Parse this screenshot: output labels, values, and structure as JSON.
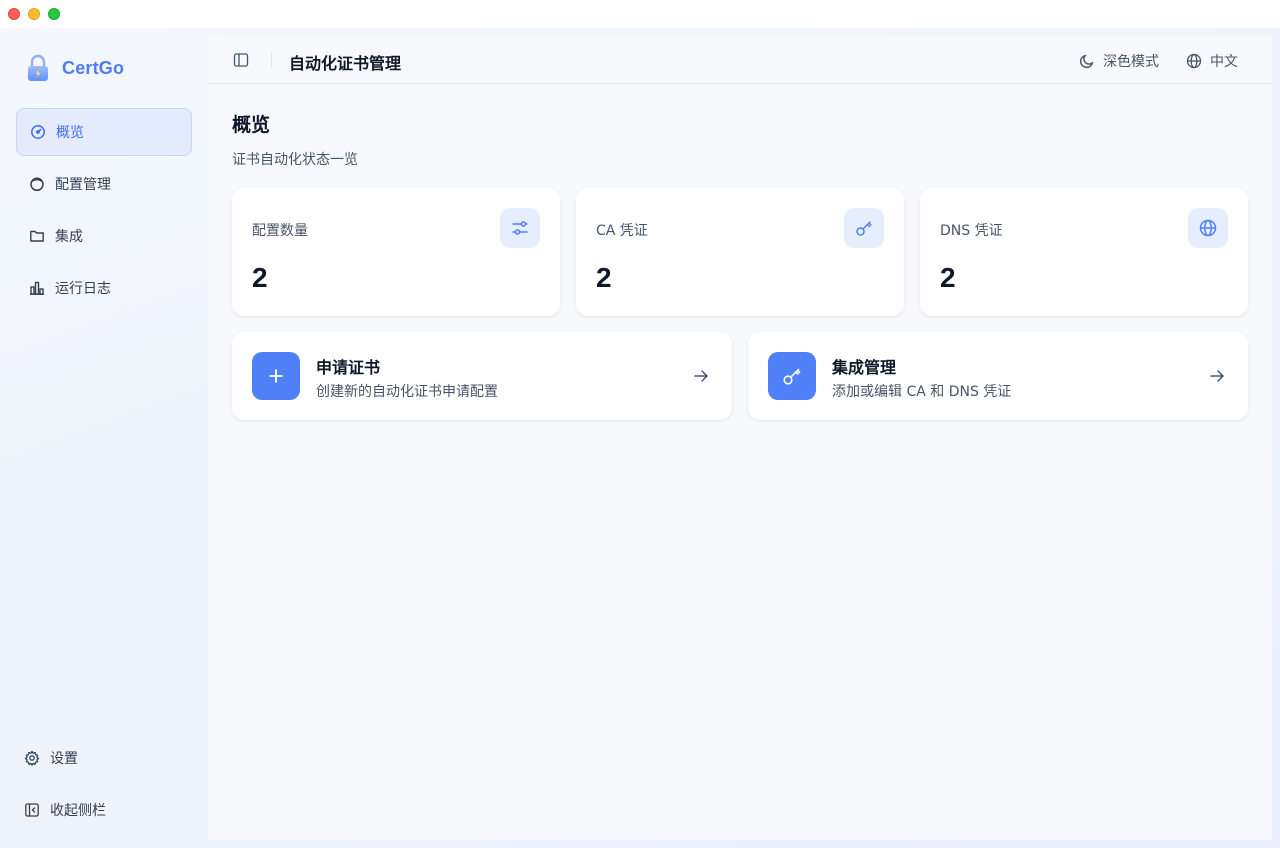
{
  "window": {
    "controls": [
      "close",
      "minimize",
      "maximize"
    ]
  },
  "sidebar": {
    "brand": {
      "name": "CertGo",
      "icon": "lock-icon",
      "color": "#4d7cf5"
    },
    "items": [
      {
        "label": "概览",
        "icon": "dashboard-icon",
        "active": true
      },
      {
        "label": "配置管理",
        "icon": "circle-icon",
        "active": false
      },
      {
        "label": "集成",
        "icon": "folder-icon",
        "active": false
      },
      {
        "label": "运行日志",
        "icon": "bar-chart-icon",
        "active": false
      }
    ],
    "settings_label": "设置",
    "collapse_label": "收起侧栏"
  },
  "header": {
    "title": "自动化证书管理",
    "theme_label": "深色模式",
    "language_label": "中文"
  },
  "page": {
    "title": "概览",
    "subtitle": "证书自动化状态一览"
  },
  "stats": [
    {
      "label": "配置数量",
      "value": "2",
      "icon": "sliders-icon"
    },
    {
      "label": "CA 凭证",
      "value": "2",
      "icon": "key-icon"
    },
    {
      "label": "DNS 凭证",
      "value": "2",
      "icon": "globe-icon"
    }
  ],
  "actions": [
    {
      "title": "申请证书",
      "desc": "创建新的自动化证书申请配置",
      "icon": "plus-icon"
    },
    {
      "title": "集成管理",
      "desc": "添加或编辑 CA 和 DNS 凭证",
      "icon": "key-icon"
    }
  ],
  "colors": {
    "accent": "#4f80f7",
    "active_bg": "#e3ebfd",
    "icon_bg": "#e6edfc"
  }
}
